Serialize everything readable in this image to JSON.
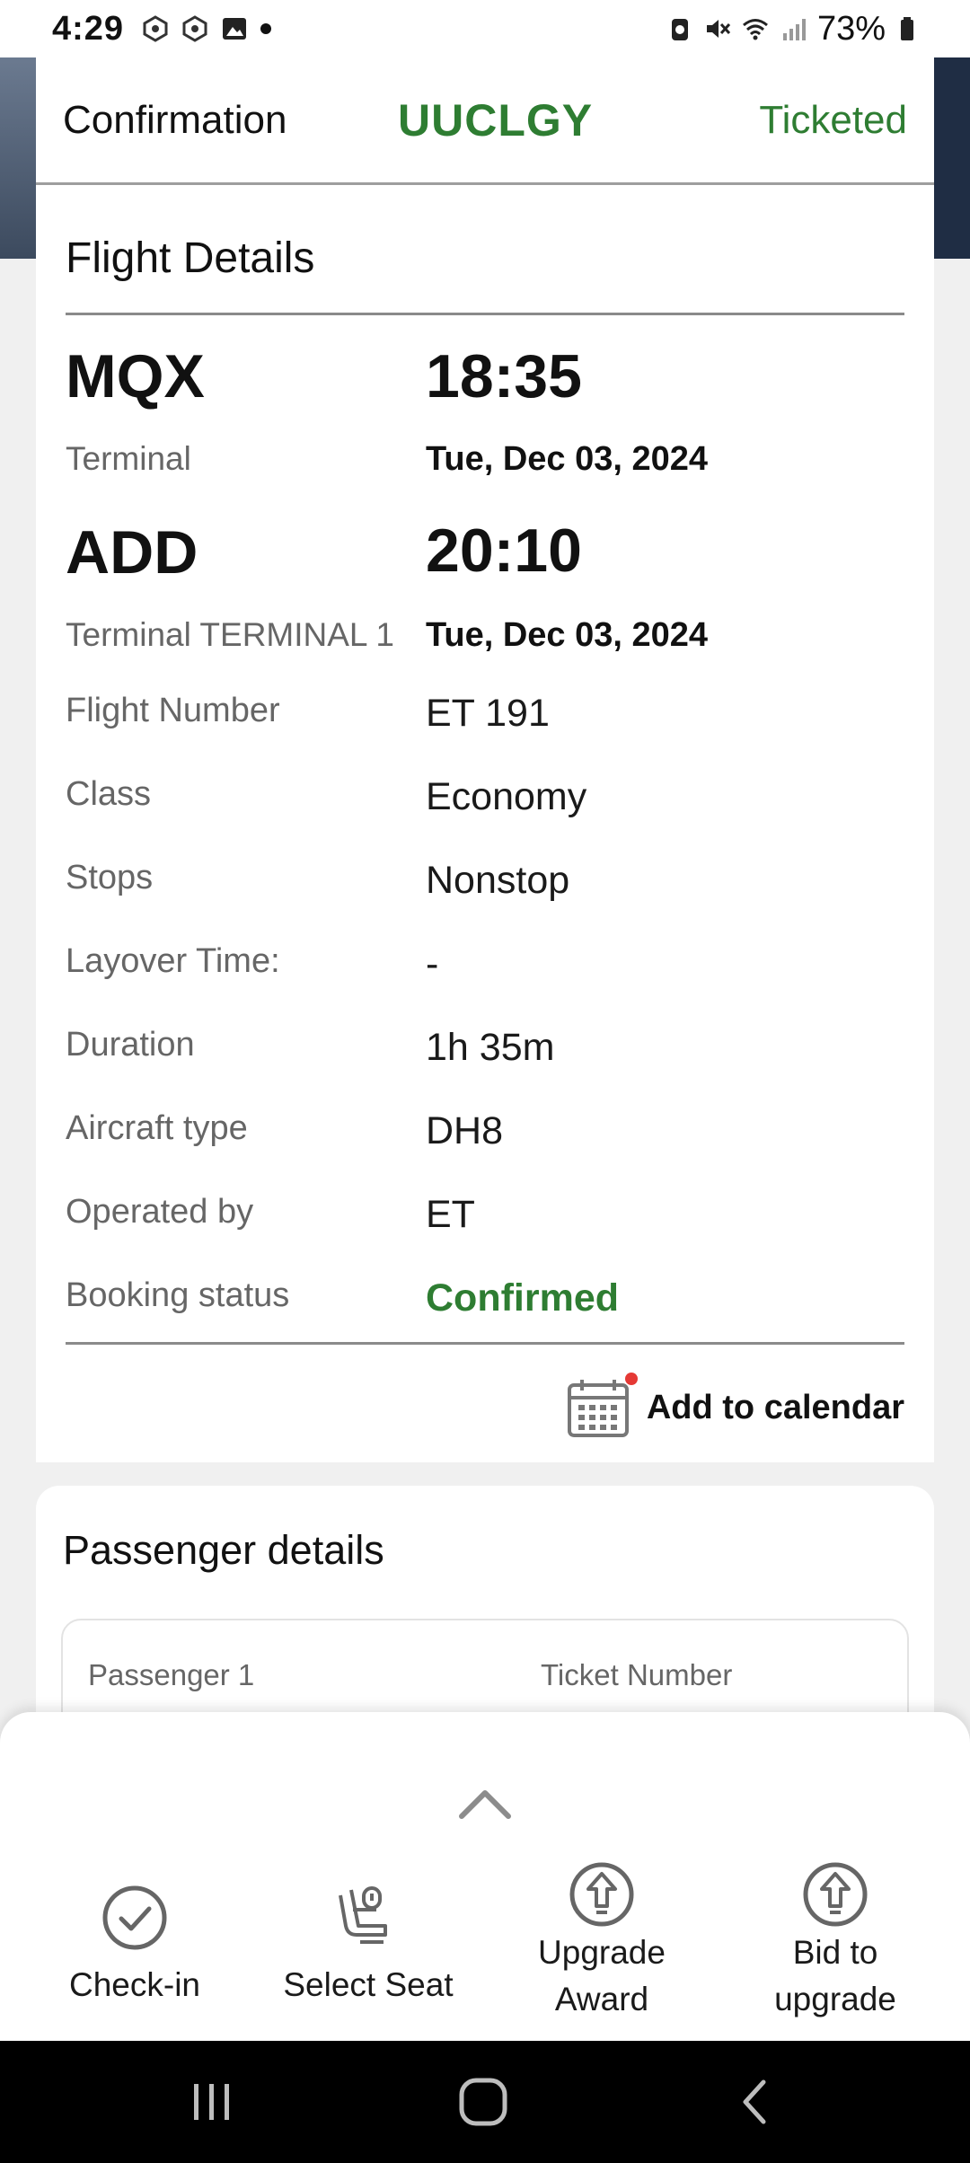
{
  "status_bar": {
    "time": "4:29",
    "battery": "73%"
  },
  "booking": {
    "confirmation_label": "Confirmation",
    "confirmation_code": "UUCLGY",
    "ticket_status": "Ticketed"
  },
  "flight_details": {
    "title": "Flight Details",
    "departure": {
      "airport": "MQX",
      "time": "18:35",
      "terminal": "Terminal",
      "date": "Tue, Dec 03, 2024"
    },
    "arrival": {
      "airport": "ADD",
      "time": "20:10",
      "terminal": "Terminal TERMINAL 1",
      "date": "Tue, Dec 03, 2024"
    },
    "rows": [
      {
        "label": "Flight Number",
        "value": "ET 191"
      },
      {
        "label": "Class",
        "value": "Economy"
      },
      {
        "label": "Stops",
        "value": "Nonstop"
      },
      {
        "label": "Layover Time:",
        "value": "-"
      },
      {
        "label": "Duration",
        "value": "1h 35m"
      },
      {
        "label": "Aircraft type",
        "value": "DH8"
      },
      {
        "label": "Operated by",
        "value": "ET"
      },
      {
        "label": "Booking status",
        "value": "Confirmed"
      }
    ],
    "add_to_calendar": "Add to calendar"
  },
  "passenger_details": {
    "title": "Passenger details",
    "passenger_label": "Passenger 1",
    "ticket_label": "Ticket Number"
  },
  "actions": [
    {
      "label": "Check-in",
      "icon": "check-circle-icon"
    },
    {
      "label": "Select Seat",
      "icon": "seat-icon"
    },
    {
      "label": "Upgrade Award",
      "icon": "upgrade-arrow-icon"
    },
    {
      "label": "Bid to upgrade",
      "icon": "upgrade-arrow-icon"
    }
  ],
  "colors": {
    "accent_green": "#2e7d32"
  }
}
